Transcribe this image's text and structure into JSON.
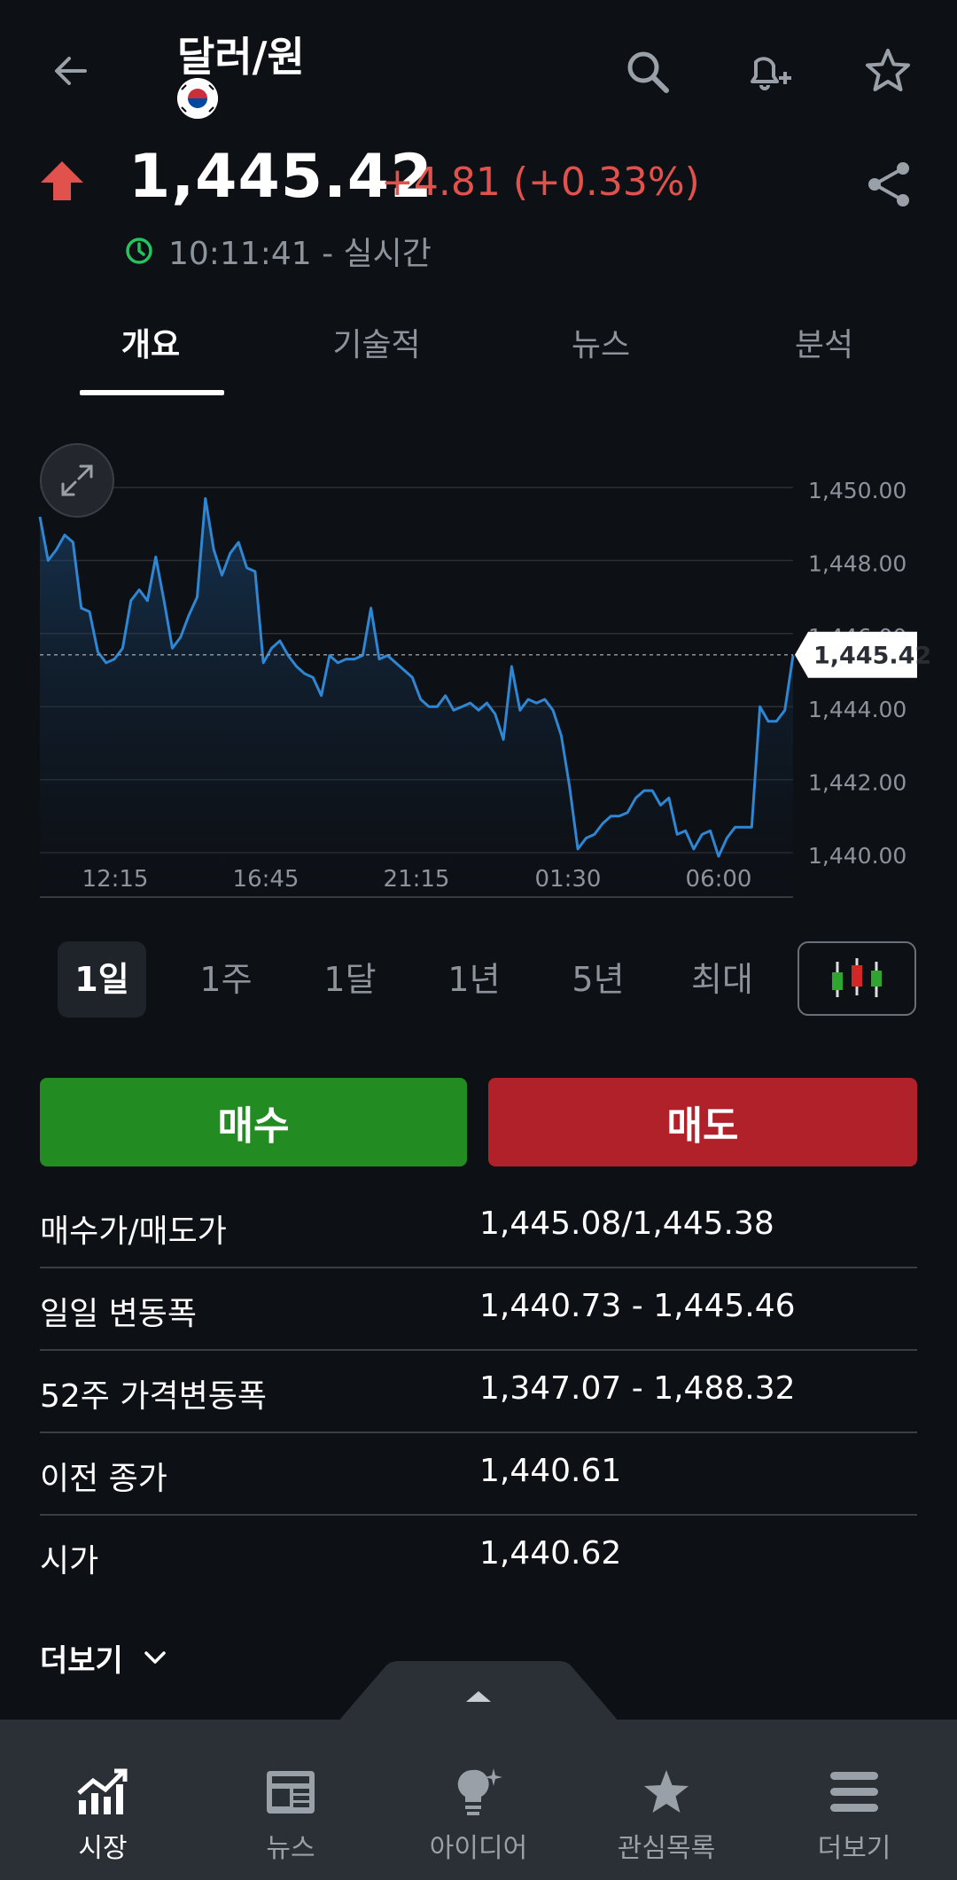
{
  "header": {
    "title": "달러/원",
    "back_icon": "back-arrow-icon",
    "search_icon": "search-icon",
    "alert_icon": "bell-plus-icon",
    "watch_icon": "star-icon"
  },
  "quote": {
    "price": "1,445.42",
    "change": "+4.81 (+0.33%)",
    "direction": "up",
    "time": "10:11:41 - 실시간",
    "up_color": "#e2524c",
    "live_color": "#22c55e"
  },
  "tabs": [
    {
      "label": "개요",
      "active": true
    },
    {
      "label": "기술적",
      "active": false
    },
    {
      "label": "뉴스",
      "active": false
    },
    {
      "label": "분석",
      "active": false
    }
  ],
  "chart_data": {
    "type": "area",
    "x_ticks": [
      "12:15",
      "16:45",
      "21:15",
      "01:30",
      "06:00"
    ],
    "y_ticks": [
      "1,450.00",
      "1,448.00",
      "1,446.00",
      "1,444.00",
      "1,442.00",
      "1,440.00"
    ],
    "ylim": [
      1440,
      1450
    ],
    "last_price_label": "1,445.42",
    "last_value": 1445.42,
    "line_color": "#2f86d3",
    "values": [
      1449.2,
      1448.0,
      1448.3,
      1448.7,
      1448.5,
      1446.7,
      1446.6,
      1445.5,
      1445.2,
      1445.3,
      1445.6,
      1446.9,
      1447.2,
      1446.9,
      1448.1,
      1446.9,
      1445.6,
      1445.9,
      1446.5,
      1447.0,
      1449.7,
      1448.3,
      1447.6,
      1448.2,
      1448.5,
      1447.8,
      1447.7,
      1445.2,
      1445.6,
      1445.8,
      1445.4,
      1445.1,
      1444.9,
      1444.8,
      1444.3,
      1445.4,
      1445.2,
      1445.3,
      1445.3,
      1445.4,
      1446.7,
      1445.3,
      1445.4,
      1445.2,
      1445.0,
      1444.8,
      1444.2,
      1444.0,
      1444.0,
      1444.3,
      1443.9,
      1444.0,
      1444.1,
      1443.9,
      1444.1,
      1443.8,
      1443.1,
      1445.1,
      1443.9,
      1444.2,
      1444.1,
      1444.2,
      1443.9,
      1443.2,
      1441.8,
      1440.1,
      1440.4,
      1440.5,
      1440.8,
      1441.0,
      1441.0,
      1441.1,
      1441.5,
      1441.7,
      1441.7,
      1441.3,
      1441.5,
      1440.5,
      1440.6,
      1440.1,
      1440.5,
      1440.6,
      1439.9,
      1440.4,
      1440.7,
      1440.7,
      1440.7,
      1444.0,
      1443.6,
      1443.6,
      1443.9,
      1445.4
    ]
  },
  "ranges": [
    {
      "label": "1일",
      "active": true
    },
    {
      "label": "1주",
      "active": false
    },
    {
      "label": "1달",
      "active": false
    },
    {
      "label": "1년",
      "active": false
    },
    {
      "label": "5년",
      "active": false
    },
    {
      "label": "최대",
      "active": false
    }
  ],
  "actions": {
    "buy": "매수",
    "sell": "매도",
    "buy_color": "#228b22",
    "sell_color": "#b0212a"
  },
  "stats": [
    {
      "label": "매수가/매도가",
      "value": "1,445.08/1,445.38"
    },
    {
      "label": "일일 변동폭",
      "value": "1,440.73 - 1,445.46"
    },
    {
      "label": "52주 가격변동폭",
      "value": "1,347.07 - 1,488.32"
    },
    {
      "label": "이전 종가",
      "value": "1,440.61"
    },
    {
      "label": "시가",
      "value": "1,440.62"
    }
  ],
  "more_label": "더보기",
  "bottom_nav": [
    {
      "label": "시장",
      "icon": "market-chart-icon",
      "active": true
    },
    {
      "label": "뉴스",
      "icon": "newspaper-icon",
      "active": false
    },
    {
      "label": "아이디어",
      "icon": "lightbulb-icon",
      "active": false
    },
    {
      "label": "관심목록",
      "icon": "star-icon",
      "active": false
    },
    {
      "label": "더보기",
      "icon": "menu-icon",
      "active": false
    }
  ]
}
